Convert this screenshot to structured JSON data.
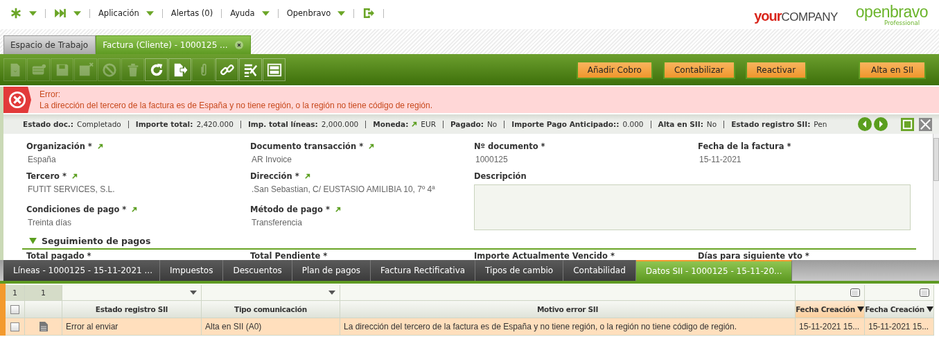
{
  "top_menu": [
    {
      "kind": "icon",
      "dropdown": true
    },
    {
      "kind": "icon",
      "dropdown": true
    },
    {
      "kind": "text",
      "label": "Aplicación",
      "dropdown": true
    },
    {
      "kind": "text",
      "label": "Alertas (0)",
      "dropdown": false
    },
    {
      "kind": "text",
      "label": "Ayuda",
      "dropdown": true
    },
    {
      "kind": "text",
      "label": "Openbravo",
      "dropdown": true
    },
    {
      "kind": "icon",
      "dropdown": false
    }
  ],
  "logos": {
    "company_bold": "your",
    "company_rest": "COMPANY",
    "brand": "openbravo",
    "edition": "Professional"
  },
  "window_tabs": [
    {
      "label": "Espacio de Trabajo",
      "selected": false,
      "closable": false
    },
    {
      "label": "Factura (Cliente) - 1000125 ...",
      "selected": true,
      "closable": true
    }
  ],
  "toolbar": [
    {
      "disabled": true
    },
    {
      "disabled": true
    },
    {
      "disabled": true
    },
    {
      "disabled": true
    },
    {
      "disabled": true
    },
    {
      "disabled": true
    },
    {
      "disabled": false
    },
    {
      "disabled": false
    },
    {
      "disabled": true
    },
    {
      "disabled": false
    },
    {
      "disabled": false
    },
    {
      "disabled": false
    }
  ],
  "action_buttons": [
    {
      "label": "Añadir Cobro"
    },
    {
      "label": "Contabilizar"
    },
    {
      "label": "Reactivar"
    },
    {
      "label": "Alta en SII"
    }
  ],
  "message": {
    "title": "Error:",
    "text": "La dirección del tercero de la factura es de España y no tiene región, o la región no tiene código de región."
  },
  "status_bar": [
    {
      "label": "Estado doc.:",
      "value": "Completado",
      "link": false
    },
    {
      "label": "Importe total:",
      "value": "2,420.000",
      "link": false
    },
    {
      "label": "Imp. total líneas:",
      "value": "2,000.000",
      "link": false
    },
    {
      "label": "Moneda:",
      "value": "EUR",
      "link": true
    },
    {
      "label": "Pagado:",
      "value": "No",
      "link": false
    },
    {
      "label": "Importe Pago Anticipado::",
      "value": "0.000",
      "link": false
    },
    {
      "label": "Alta en SII:",
      "value": "No",
      "link": false
    },
    {
      "label": "Estado registro SII:",
      "value": "Pen",
      "link": false
    }
  ],
  "form_fields": [
    {
      "kind": "text",
      "label": "Organización *",
      "link": true,
      "value": "España"
    },
    {
      "kind": "text",
      "label": "Documento transacción *",
      "link": true,
      "value": "AR Invoice"
    },
    {
      "kind": "text",
      "label": "Nº documento *",
      "link": false,
      "value": "1000125"
    },
    {
      "kind": "text",
      "label": "Fecha de la factura *",
      "link": false,
      "value": "15-11-2021"
    },
    {
      "kind": "text",
      "label": "Tercero *",
      "link": true,
      "value": "FUTIT SERVICES, S.L."
    },
    {
      "kind": "text",
      "label": "Dirección *",
      "link": true,
      "value": ".San Sebastian, C/ EUSTASIO AMILIBIA 10, 7º 4ª"
    },
    {
      "kind": "textarea",
      "label": "Descripción",
      "link": false
    },
    {
      "kind": "text",
      "label": "Condiciones de pago *",
      "link": true,
      "value": "Treinta días"
    },
    {
      "kind": "text",
      "label": "Método de pago *",
      "link": true,
      "value": "Transferencia"
    }
  ],
  "section": {
    "title": "Seguimiento de pagos",
    "expanded": true,
    "fields": [
      {
        "label": "Total pagado *"
      },
      {
        "label": "Total Pendiente *"
      },
      {
        "label": "Importe Actualmente Vencido *"
      },
      {
        "label": "Días para siguiente vto *"
      }
    ]
  },
  "child_tabs": [
    {
      "label": "Líneas - 1000125 - 15-11-2021 ...",
      "selected": false
    },
    {
      "label": "Impuestos",
      "selected": false
    },
    {
      "label": "Descuentos",
      "selected": false
    },
    {
      "label": "Plan de pagos",
      "selected": false
    },
    {
      "label": "Factura Rectificativa",
      "selected": false
    },
    {
      "label": "Tipos de cambio",
      "selected": false
    },
    {
      "label": "Contabilidad",
      "selected": false
    },
    {
      "label": "Datos SII - 1000125 - 15-11-20...",
      "selected": true
    }
  ],
  "grid": {
    "row_counts": [
      "1",
      "1"
    ],
    "select_all_checked": false,
    "columns": [
      {
        "header": "Estado registro SII",
        "filter": {
          "kind": "dropdown"
        },
        "sorted": false,
        "highlighted": false
      },
      {
        "header": "Tipo comunicación",
        "filter": {
          "kind": "dropdown"
        },
        "sorted": false,
        "highlighted": false
      },
      {
        "header": "Motivo error SII",
        "filter": {
          "kind": "text"
        },
        "sorted": false,
        "highlighted": false
      },
      {
        "header": "Fecha Creación",
        "filter": {
          "kind": "date"
        },
        "sorted": true,
        "highlighted": true
      },
      {
        "header": "Fecha Creación",
        "filter": {
          "kind": "date"
        },
        "sorted": true,
        "highlighted": false
      }
    ],
    "rows": [
      {
        "selected": true,
        "checked": false,
        "cells": [
          "Error al enviar",
          "Alta en SII (A0)",
          "La dirección del tercero de la factura es de España y no tiene región, o la región no tiene código de región.",
          "15-11-2021 15...",
          "15-11-2021 15..."
        ]
      }
    ]
  }
}
